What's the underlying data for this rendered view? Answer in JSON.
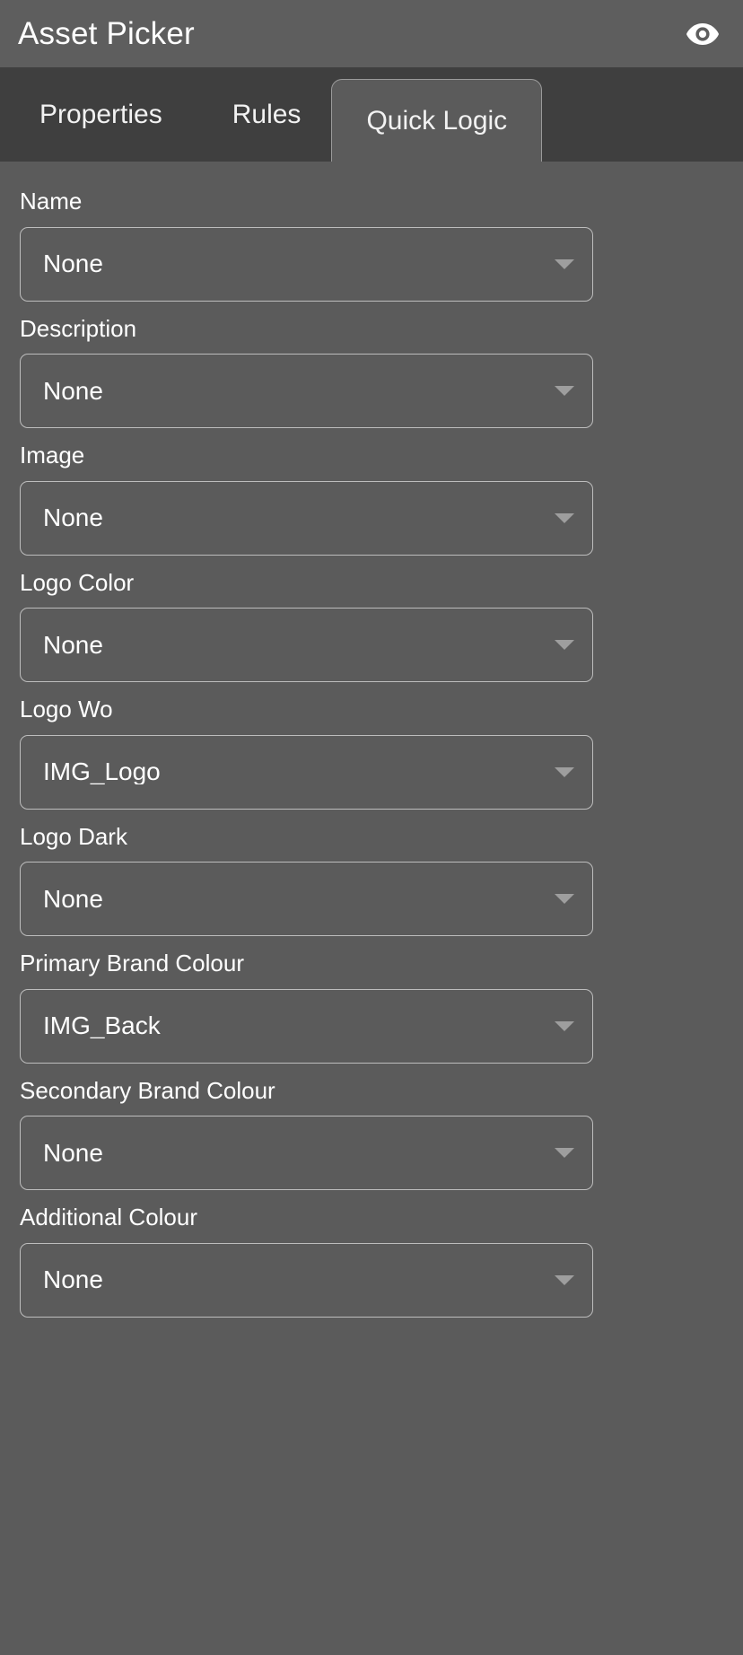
{
  "window": {
    "title": "Asset Picker"
  },
  "header": {
    "title": "Asset Picker",
    "preview_icon": "eye-icon",
    "background_color": "#5e5e5e"
  },
  "tabs": {
    "items": [
      {
        "label": "Properties",
        "active": false
      },
      {
        "label": "Rules",
        "active": false
      },
      {
        "label": "Quick Logic",
        "active": true
      }
    ],
    "bar_background_color": "#3f3f3f",
    "active_tab_background_color": "#5b5b5b",
    "active_tab_border_color": "#9a9a9a"
  },
  "form": {
    "background_color": "#5b5b5b",
    "field_border_color": "#bdbdbd",
    "arrow_icon": "chevron-down-icon",
    "arrow_color": "#9e9e9e",
    "fields": [
      {
        "label": "Name",
        "value": "None"
      },
      {
        "label": "Description",
        "value": "None"
      },
      {
        "label": "Image",
        "value": "None"
      },
      {
        "label": "Logo Color",
        "value": "None"
      },
      {
        "label": "Logo Wo",
        "value": "IMG_Logo"
      },
      {
        "label": "Logo Dark",
        "value": "None"
      },
      {
        "label": "Primary Brand Colour",
        "value": "IMG_Back"
      },
      {
        "label": "Secondary Brand Colour",
        "value": "None"
      },
      {
        "label": "Additional Colour",
        "value": "None"
      }
    ]
  }
}
